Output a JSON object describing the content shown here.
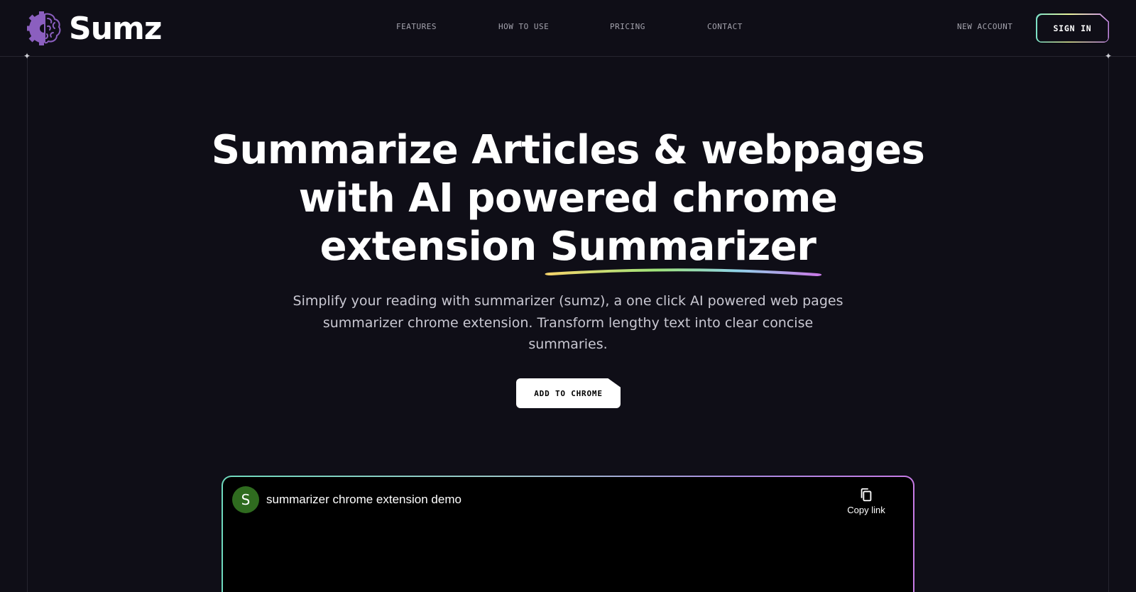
{
  "brand": {
    "name": "Sumz",
    "logo_icon": "gear-brain-icon",
    "logo_color": "#8b5fbf"
  },
  "nav": {
    "features": "FEATURES",
    "how_to_use": "HOW TO USE",
    "pricing": "PRICING",
    "contact": "CONTACT",
    "new_account": "NEW ACCOUNT",
    "sign_in": "SIGN IN"
  },
  "hero": {
    "title_line1": "Summarize Articles & webpages",
    "title_line2": "with AI powered chrome",
    "title_line3_prefix": "extension ",
    "title_highlight": "Summarizer",
    "subtitle": "Simplify your reading with summarizer (sumz), a one click AI powered web pages summarizer chrome extension. Transform lengthy text into clear concise summaries.",
    "cta_label": "ADD TO CHROME"
  },
  "video": {
    "channel_initial": "S",
    "title": "summarizer chrome extension demo",
    "copy_label": "Copy link",
    "copy_icon": "copy-icon"
  },
  "colors": {
    "background": "#0f0e17",
    "accent_gradient": [
      "#f3d46b",
      "#9fe37a",
      "#8fd3e8",
      "#c77be6"
    ],
    "avatar": "#2f6b1f"
  }
}
